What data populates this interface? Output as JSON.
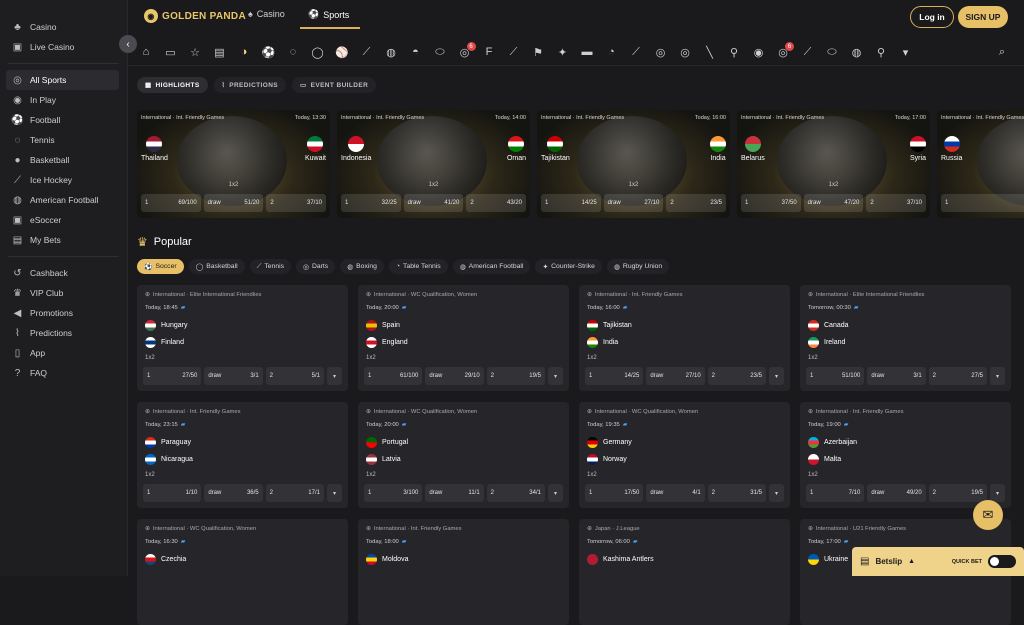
{
  "sidebar": {
    "top": [
      {
        "label": "Casino",
        "icon": "casino-icon"
      },
      {
        "label": "Live Casino",
        "icon": "live-casino-icon"
      }
    ],
    "sports": [
      {
        "label": "All Sports",
        "icon": "all-sports-icon",
        "active": true
      },
      {
        "label": "In Play",
        "icon": "in-play-icon"
      },
      {
        "label": "Football",
        "icon": "football-icon"
      },
      {
        "label": "Tennis",
        "icon": "tennis-icon"
      },
      {
        "label": "Basketball",
        "icon": "basketball-icon"
      },
      {
        "label": "Ice Hockey",
        "icon": "ice-hockey-icon"
      },
      {
        "label": "American Football",
        "icon": "american-football-icon"
      },
      {
        "label": "eSoccer",
        "icon": "esoccer-icon"
      },
      {
        "label": "My Bets",
        "icon": "my-bets-icon"
      }
    ],
    "extra": [
      {
        "label": "Cashback",
        "icon": "cashback-icon"
      },
      {
        "label": "VIP Club",
        "icon": "vip-crown-icon"
      },
      {
        "label": "Promotions",
        "icon": "megaphone-icon"
      },
      {
        "label": "Predictions",
        "icon": "predictions-icon"
      },
      {
        "label": "App",
        "icon": "phone-icon"
      },
      {
        "label": "FAQ",
        "icon": "faq-icon"
      }
    ]
  },
  "header": {
    "logo": "GOLDEN PANDA",
    "tab_casino": "Casino",
    "tab_sports": "Sports",
    "login": "Log in",
    "signup": "SIGN UP"
  },
  "sport_icons_badges": {
    "b1": "6",
    "b2": "6"
  },
  "subtabs": [
    "HIGHLIGHTS",
    "PREDICTIONS",
    "EVENT BUILDER"
  ],
  "highlights": [
    {
      "league": "International · Int. Friendly Games",
      "time": "Today, 13:30",
      "home": "Thailand",
      "away": "Kuwait",
      "market": "1x2",
      "o1": "69/100",
      "ox": "51/20",
      "o2": "37/10",
      "hc": [
        "#a51931",
        "#fff",
        "#2d2a4a"
      ],
      "ac": [
        "#007a3d",
        "#fff",
        "#ce1126"
      ]
    },
    {
      "league": "International · Int. Friendly Games",
      "time": "Today, 14:00",
      "home": "Indonesia",
      "away": "Oman",
      "market": "1x2",
      "o1": "32/25",
      "ox": "41/20",
      "o2": "43/20",
      "hc": [
        "#ce1126",
        "#fff"
      ],
      "ac": [
        "#db161b",
        "#fff",
        "#008000"
      ]
    },
    {
      "league": "International · Int. Friendly Games",
      "time": "Today, 16:00",
      "home": "Tajikistan",
      "away": "India",
      "market": "1x2",
      "o1": "14/25",
      "ox": "27/10",
      "o2": "23/5",
      "hc": [
        "#cc0000",
        "#fff",
        "#006600"
      ],
      "ac": [
        "#ff9933",
        "#fff",
        "#138808"
      ]
    },
    {
      "league": "International · Int. Friendly Games",
      "time": "Today, 17:00",
      "home": "Belarus",
      "away": "Syria",
      "market": "1x2",
      "o1": "37/50",
      "ox": "47/20",
      "o2": "37/10",
      "hc": [
        "#c8313e",
        "#4aa657"
      ],
      "ac": [
        "#ce1126",
        "#fff",
        "#000"
      ]
    },
    {
      "league": "International · Int. Friendly Games",
      "time": "",
      "home": "Russia",
      "away": "",
      "market": "",
      "o1": "9/25",
      "ox": "",
      "o2": "",
      "hc": [
        "#fff",
        "#0039a6",
        "#d52b1e"
      ],
      "ac": []
    }
  ],
  "popular": {
    "title": "Popular",
    "filters": [
      "Soccer",
      "Basketball",
      "Tennis",
      "Darts",
      "Boxing",
      "Table Tennis",
      "American Football",
      "Counter-Strike",
      "Rugby Union"
    ]
  },
  "matches": [
    {
      "league": "International · Elite International Friendlies",
      "time": "Today, 18:45",
      "home": "Hungary",
      "away": "Finland",
      "market": "1x2",
      "o1": "27/50",
      "ox": "3/1",
      "o2": "5/1",
      "hc": [
        "#ce2939",
        "#fff",
        "#477050"
      ],
      "ac": [
        "#fff",
        "#003580",
        "#fff"
      ]
    },
    {
      "league": "International · WC Qualification, Women",
      "time": "Today, 20:00",
      "home": "Spain",
      "away": "England",
      "market": "1x2",
      "o1": "61/100",
      "ox": "29/10",
      "o2": "19/5",
      "hc": [
        "#aa151b",
        "#f1bf00",
        "#aa151b"
      ],
      "ac": [
        "#fff",
        "#ce1124",
        "#fff"
      ]
    },
    {
      "league": "International · Int. Friendly Games",
      "time": "Today, 16:00",
      "home": "Tajikistan",
      "away": "India",
      "market": "1x2",
      "o1": "14/25",
      "ox": "27/10",
      "o2": "23/5",
      "hc": [
        "#cc0000",
        "#fff",
        "#006600"
      ],
      "ac": [
        "#ff9933",
        "#fff",
        "#138808"
      ]
    },
    {
      "league": "International · Elite International Friendlies",
      "time": "Tomorrow, 00:30",
      "home": "Canada",
      "away": "Ireland",
      "market": "1x2",
      "o1": "51/100",
      "ox": "3/1",
      "o2": "27/5",
      "hc": [
        "#d52b1e",
        "#fff",
        "#d52b1e"
      ],
      "ac": [
        "#169b62",
        "#fff",
        "#ff883e"
      ]
    },
    {
      "league": "International · Int. Friendly Games",
      "time": "Today, 23:15",
      "home": "Paraguay",
      "away": "Nicaragua",
      "market": "1x2",
      "o1": "1/10",
      "ox": "36/5",
      "o2": "17/1",
      "hc": [
        "#d52b1e",
        "#fff",
        "#0038a8"
      ],
      "ac": [
        "#0067c6",
        "#fff",
        "#0067c6"
      ]
    },
    {
      "league": "International · WC Qualification, Women",
      "time": "Today, 20:00",
      "home": "Portugal",
      "away": "Latvia",
      "market": "1x2",
      "o1": "3/100",
      "ox": "11/1",
      "o2": "34/1",
      "hc": [
        "#006600",
        "#ff0000"
      ],
      "ac": [
        "#9e3039",
        "#fff",
        "#9e3039"
      ]
    },
    {
      "league": "International · WC Qualification, Women",
      "time": "Today, 19:35",
      "home": "Germany",
      "away": "Norway",
      "market": "1x2",
      "o1": "17/50",
      "ox": "4/1",
      "o2": "31/5",
      "hc": [
        "#000",
        "#dd0000",
        "#ffce00"
      ],
      "ac": [
        "#ba0c2f",
        "#fff",
        "#00205b"
      ]
    },
    {
      "league": "International · Int. Friendly Games",
      "time": "Today, 19:00",
      "home": "Azerbaijan",
      "away": "Malta",
      "market": "1x2",
      "o1": "7/10",
      "ox": "49/20",
      "o2": "19/5",
      "hc": [
        "#00b5e2",
        "#ef3340",
        "#509e2f"
      ],
      "ac": [
        "#fff",
        "#cf142b"
      ]
    },
    {
      "league": "International · WC Qualification, Women",
      "time": "Today, 16:30",
      "home": "Czechia",
      "away": "",
      "market": "",
      "o1": "",
      "ox": "",
      "o2": "",
      "hc": [
        "#fff",
        "#d7141a",
        "#11457e"
      ],
      "ac": []
    },
    {
      "league": "International · Int. Friendly Games",
      "time": "Today, 18:00",
      "home": "Moldova",
      "away": "",
      "market": "",
      "o1": "",
      "ox": "",
      "o2": "",
      "hc": [
        "#0046ae",
        "#ffd200",
        "#cc092f"
      ],
      "ac": []
    },
    {
      "league": "Japan · J.League",
      "time": "Tomorrow, 06:00",
      "home": "Kashima Antlers",
      "away": "",
      "market": "",
      "o1": "",
      "ox": "",
      "o2": "",
      "hc": [
        "#b01c35",
        "#b01c35"
      ],
      "ac": []
    },
    {
      "league": "International · U21 Friendly Games",
      "time": "Today, 17:00",
      "home": "Ukraine",
      "away": "",
      "market": "",
      "o1": "",
      "ox": "",
      "o2": "",
      "hc": [
        "#0057b7",
        "#ffd700"
      ],
      "ac": []
    }
  ],
  "draw_label": "draw",
  "one_label": "1",
  "two_label": "2",
  "betslip": {
    "label": "Betslip",
    "quick": "QUICK BET"
  }
}
